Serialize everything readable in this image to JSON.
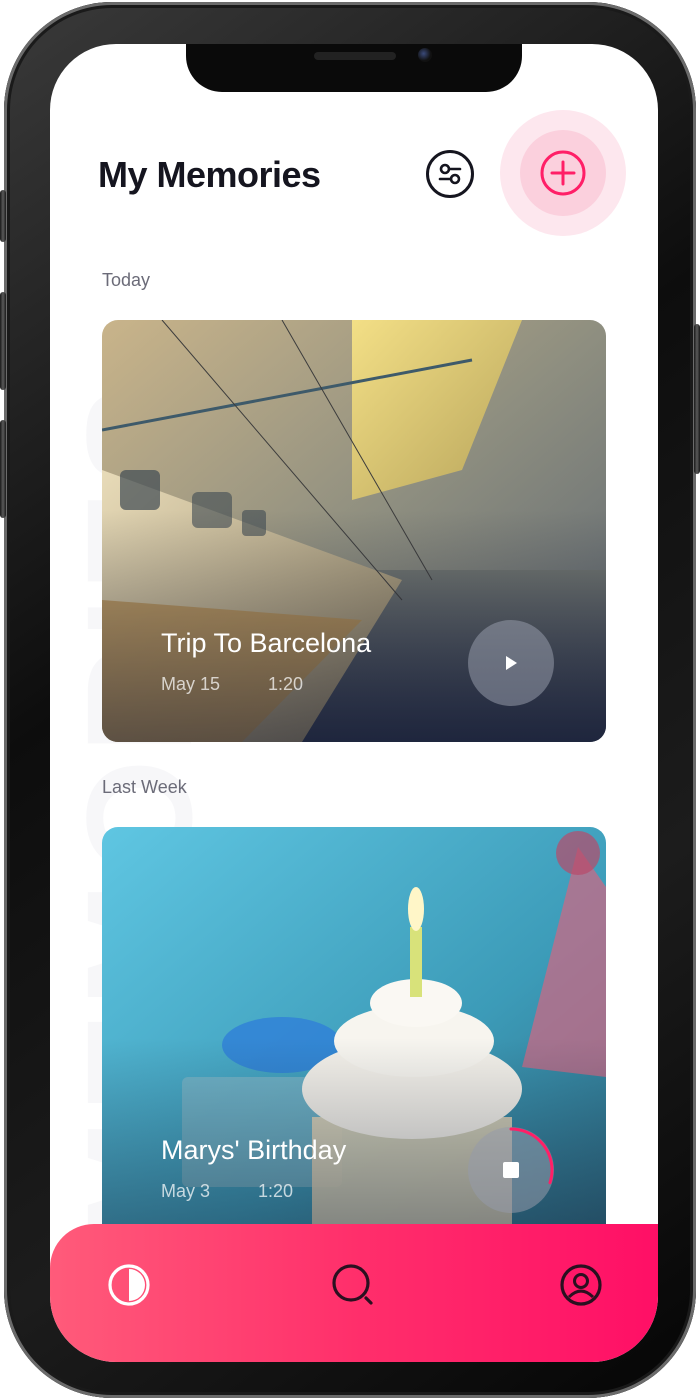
{
  "header": {
    "title": "My Memories",
    "filter_icon": "sliders-icon",
    "add_icon": "plus-circle-icon"
  },
  "watermark_text": "MEMORIES",
  "sections": [
    {
      "label": "Today",
      "card": {
        "title": "Trip To Barcelona",
        "date": "May 15",
        "duration": "1:20",
        "control": "play-icon"
      }
    },
    {
      "label": "Last Week",
      "card": {
        "title": "Marys' Birthday",
        "date": "May 3",
        "duration": "1:20",
        "control": "stop-icon",
        "progress_fraction": 0.3
      }
    }
  ],
  "tabbar": {
    "items": [
      "contrast-icon",
      "search-icon",
      "profile-icon"
    ]
  },
  "colors": {
    "accent": "#ff1f67",
    "accent_light": "#fbd0dd",
    "title": "#15151f",
    "muted": "#6b6b78"
  }
}
